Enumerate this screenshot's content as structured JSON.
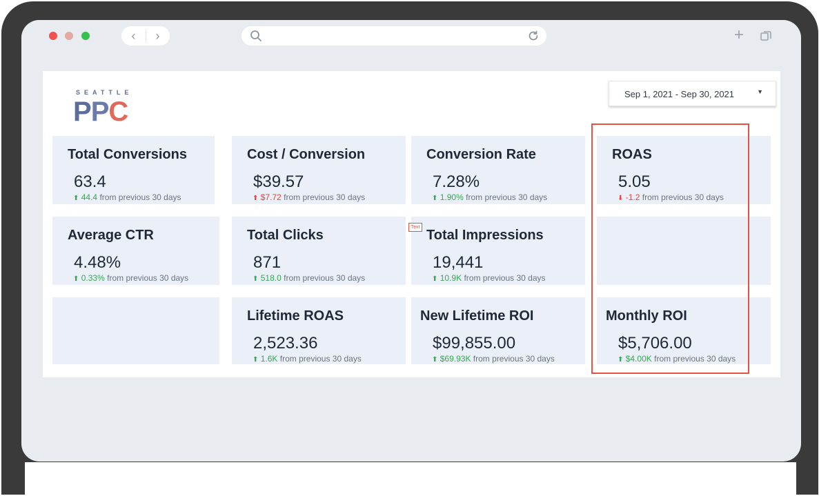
{
  "date_range": {
    "label": "Sep 1, 2021 - Sep 30, 2021"
  },
  "logo": {
    "top": "SEATTLE",
    "main_p1": "P",
    "main_p2": "P",
    "main_c": "C"
  },
  "tag": {
    "label": "Text"
  },
  "cards": {
    "total_conversions": {
      "title": "Total Conversions",
      "value": "63.4",
      "delta": "44.4",
      "suffix": "from previous 30 days",
      "direction": "up"
    },
    "cost_conversion": {
      "title": "Cost / Conversion",
      "value": "$39.57",
      "delta": "$7.72",
      "suffix": "from previous 30 days",
      "direction": "up-red"
    },
    "conversion_rate": {
      "title": "Conversion Rate",
      "value": "7.28%",
      "delta": "1.90%",
      "suffix": "from previous 30 days",
      "direction": "up"
    },
    "roas": {
      "title": "ROAS",
      "value": "5.05",
      "delta": "-1.2",
      "suffix": "from previous 30 days",
      "direction": "down"
    },
    "average_ctr": {
      "title": "Average CTR",
      "value": "4.48%",
      "delta": "0.33%",
      "suffix": "from previous 30 days",
      "direction": "up"
    },
    "total_clicks": {
      "title": "Total Clicks",
      "value": "871",
      "delta": "518.0",
      "suffix": "from previous 30 days",
      "direction": "up"
    },
    "total_impressions": {
      "title": "Total Impressions",
      "value": "19,441",
      "delta": "10.9K",
      "suffix": "from previous 30 days",
      "direction": "up"
    },
    "lifetime_roas": {
      "title": "Lifetime ROAS",
      "value": "2,523.36",
      "delta": "1.6K",
      "suffix": "from previous 30 days",
      "direction": "up"
    },
    "new_lifetime_roi": {
      "title": "New Lifetime ROI",
      "value": "$99,855.00",
      "delta": "$69.93K",
      "suffix": "from previous 30 days",
      "direction": "up"
    },
    "monthly_roi": {
      "title": "Monthly ROI",
      "value": "$5,706.00",
      "delta": "$4.00K",
      "suffix": "from previous 30 days",
      "direction": "up"
    }
  },
  "colors": {
    "accent_up": "#34a853",
    "accent_down": "#e8443a",
    "highlight": "#e5533e",
    "card_bg": "#ebf0f8"
  },
  "icons": {
    "back": "chevron-left-icon",
    "forward": "chevron-right-icon",
    "search": "search-icon",
    "reload": "reload-icon",
    "new_tab": "plus-icon",
    "tabs": "tabs-icon"
  }
}
